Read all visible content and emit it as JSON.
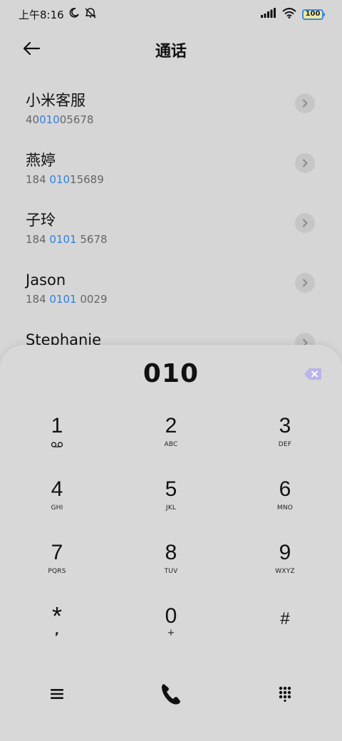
{
  "status_bar": {
    "time": "上午8:16",
    "battery": "100",
    "icons": [
      "moon-icon",
      "mute-icon",
      "signal-icon",
      "wifi-icon",
      "battery-icon"
    ]
  },
  "header": {
    "title": "通话",
    "back_icon": "back-arrow-icon"
  },
  "contacts": [
    {
      "name": "小米客服",
      "num_pre": "40",
      "num_hl": "010",
      "num_post": "05678"
    },
    {
      "name": "燕婷",
      "num_pre": "184 ",
      "num_hl": "010",
      "num_post": "15689"
    },
    {
      "name": "子玲",
      "num_pre": "184 ",
      "num_hl": "0101",
      "num_post": " 5678"
    },
    {
      "name": "Jason",
      "num_pre": "184 ",
      "num_hl": "0101",
      "num_post": " 0029"
    },
    {
      "name": "Stephanie",
      "num_pre": "",
      "num_hl": "",
      "num_post": ""
    }
  ],
  "dialer": {
    "dialed_number": "010",
    "delete_icon": "backspace-icon",
    "delete_color": "#b9b4ea",
    "keys": [
      [
        {
          "digit": "1",
          "letters": ""
        },
        {
          "digit": "2",
          "letters": "ABC"
        },
        {
          "digit": "3",
          "letters": "DEF"
        }
      ],
      [
        {
          "digit": "4",
          "letters": "GHI"
        },
        {
          "digit": "5",
          "letters": "JKL"
        },
        {
          "digit": "6",
          "letters": "MNO"
        }
      ],
      [
        {
          "digit": "7",
          "letters": "PQRS"
        },
        {
          "digit": "8",
          "letters": "TUV"
        },
        {
          "digit": "9",
          "letters": "WXYZ"
        }
      ],
      [
        {
          "digit": "*",
          "letters": ","
        },
        {
          "digit": "0",
          "letters": "+"
        },
        {
          "digit": "#",
          "letters": ""
        }
      ]
    ],
    "bottom": [
      "menu-icon",
      "phone-call-icon",
      "dialpad-icon"
    ]
  },
  "colors": {
    "highlight": "#2f80e0",
    "background": "#d6d6d6"
  }
}
